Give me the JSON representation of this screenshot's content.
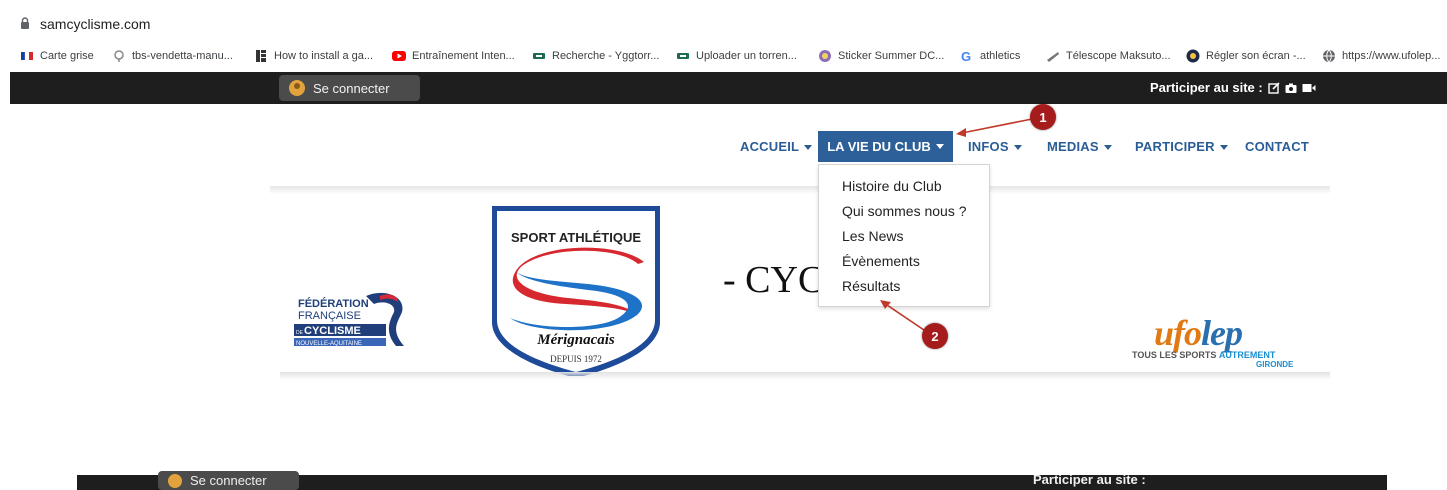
{
  "browser": {
    "url": "samcyclisme.com",
    "bookmarks": [
      {
        "label": "Carte grise",
        "icon": "french-flag-icon"
      },
      {
        "label": "tbs-vendetta-manu...",
        "icon": "sprocket-icon"
      },
      {
        "label": "How to install a ga...",
        "icon": "page-icon"
      },
      {
        "label": "Entraînement Inten...",
        "icon": "youtube-icon"
      },
      {
        "label": "Recherche - Yggtorr...",
        "icon": "ygg-icon"
      },
      {
        "label": "Uploader un torren...",
        "icon": "ygg-icon"
      },
      {
        "label": "Sticker Summer DC...",
        "icon": "sticker-icon"
      },
      {
        "label": "athletics",
        "icon": "google-icon"
      },
      {
        "label": "Télescope Maksuto...",
        "icon": "telescope-icon"
      },
      {
        "label": "Régler son écran -...",
        "icon": "screen-icon"
      },
      {
        "label": "https://www.ufolep...",
        "icon": "globe-icon"
      }
    ]
  },
  "topbar": {
    "connect_label": "Se connecter",
    "participer_label": "Participer au site :"
  },
  "nav": {
    "items": [
      {
        "label": "ACCUEIL",
        "has_caret": true
      },
      {
        "label": "LA VIE DU CLUB",
        "has_caret": true,
        "active": true
      },
      {
        "label": "INFOS",
        "has_caret": true
      },
      {
        "label": "MEDIAS",
        "has_caret": true
      },
      {
        "label": "PARTICIPER",
        "has_caret": true
      },
      {
        "label": "CONTACT",
        "has_caret": false
      }
    ]
  },
  "dropdown": {
    "items": [
      "Histoire du Club",
      "Qui sommes nous ?",
      "Les News",
      "Évènements",
      "Résultats"
    ]
  },
  "banner": {
    "ffc_lines": [
      "FÉDÉRATION",
      "FRANÇAISE",
      "CYCLISME",
      "NOUVELLE-AQUITAINE"
    ],
    "ffc_prefix": "DE",
    "sam_top": "SPORT ATHLÉTIQUE",
    "sam_name": "Mérignacais",
    "sam_since": "DEPUIS 1972",
    "title": "- CYC",
    "ufolep_word_a": "ufo",
    "ufolep_word_b": "lep",
    "ufolep_sub_a": "TOUS LES SPORTS",
    "ufolep_sub_b": "AUTREMENT",
    "ufolep_sub_c": "GIRONDE"
  },
  "annotations": [
    "1",
    "2"
  ],
  "colors": {
    "nav_text": "#2a5d95",
    "nav_active_bg": "#2d5f99",
    "annotation": "#a61b1b",
    "topbar": "#1e1e1e"
  }
}
